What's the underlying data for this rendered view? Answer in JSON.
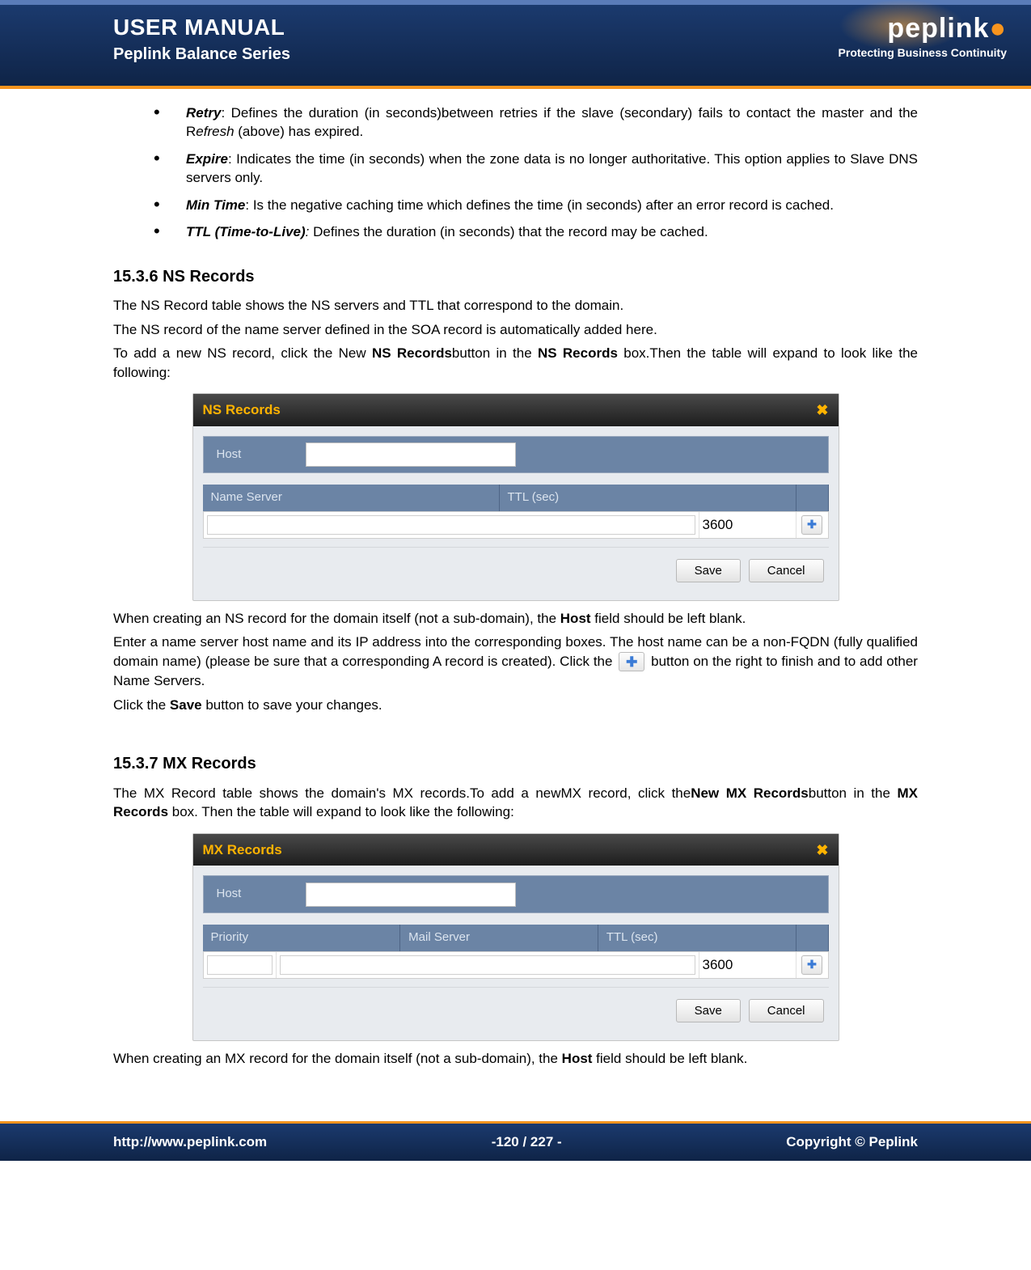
{
  "header": {
    "title": "USER MANUAL",
    "subtitle": "Peplink Balance Series",
    "brand": "peplink",
    "tagline": "Protecting Business Continuity"
  },
  "bullets": [
    {
      "term": "Retry",
      "rest": ": Defines the duration (in seconds)between retries if the slave (secondary) fails to contact the master and the R",
      "em": "efresh",
      "tail": " (above) has expired."
    },
    {
      "term": "Expire",
      "rest": ": Indicates the time (in seconds) when the zone data is no longer authoritative. This option applies to Slave DNS servers only.",
      "em": "",
      "tail": ""
    },
    {
      "term": "Min Time",
      "rest": ": Is the negative caching time which defines the time (in seconds) after an error record is cached.",
      "em": "",
      "tail": ""
    },
    {
      "term": "TTL (Time-to-Live)",
      "rest": "",
      "em": ":",
      "tail": " Defines the duration (in seconds) that the record may be cached."
    }
  ],
  "ns": {
    "heading": "15.3.6 NS Records",
    "p1": "The NS Record table shows the NS servers and TTL that correspond to the domain.",
    "p2": "The NS record of the name server defined in the SOA record is automatically added here.",
    "p3a": "To add a new NS record, click the New ",
    "p3b": "NS Records",
    "p3c": "button in the ",
    "p3d": "NS Records",
    "p3e": " box.Then the table will expand to look like the following:",
    "box_title": "NS Records",
    "host_label": "Host",
    "name_server_label": "Name Server",
    "ttl_label": "TTL (sec)",
    "ttl_value": "3600",
    "save": "Save",
    "cancel": "Cancel",
    "after1a": "When creating an NS record for the domain itself (not a sub-domain), the ",
    "after1b": "Host",
    "after1c": " field should be left blank.",
    "after2": "Enter a name server host name and its IP address into the corresponding boxes. The host name can be a non-FQDN (fully qualified domain name) (please be sure that a corresponding A record is created). Click the",
    "after3": " button on the right to finish and to add other Name Servers.",
    "after4a": "Click the ",
    "after4b": "Save",
    "after4c": " button to save your changes.",
    "plus": "✚"
  },
  "mx": {
    "heading": "15.3.7 MX Records",
    "p1a": "The MX Record table shows the domain's MX records.To add a newMX record, click the",
    "p1b": "New MX Records",
    "p1c": "button in the ",
    "p1d": "MX Records",
    "p1e": " box.  Then the table will expand to look like the following:",
    "box_title": "MX Records",
    "host_label": "Host",
    "priority_label": "Priority",
    "mail_server_label": "Mail Server",
    "ttl_label": "TTL (sec)",
    "ttl_value": "3600",
    "save": "Save",
    "cancel": "Cancel",
    "after1a": "When creating an MX record for the domain itself (not a sub-domain), the ",
    "after1b": "Host",
    "after1c": " field should be left blank.",
    "plus": "✚"
  },
  "footer": {
    "url": "http://www.peplink.com",
    "page": "-120 / 227 -",
    "copy": "Copyright ©  Peplink"
  }
}
